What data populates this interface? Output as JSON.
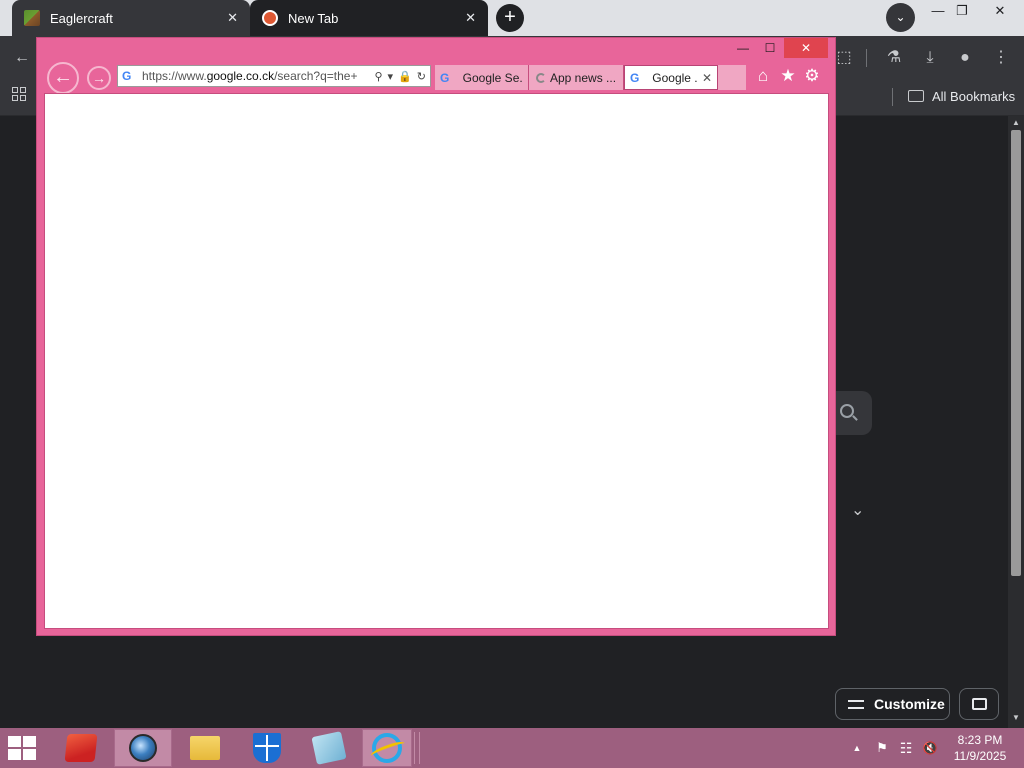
{
  "chrome": {
    "tabs": [
      {
        "title": "Eaglercraft",
        "close": "✕",
        "favicon": "eaglercraft-favicon"
      },
      {
        "title": "New Tab",
        "close": "✕",
        "favicon": "duckduckgo-favicon"
      }
    ],
    "new_tab_symbol": "+",
    "tab_search_symbol": "⌄",
    "window_controls": {
      "minimize": "—",
      "restore": "❐",
      "close": "✕"
    },
    "toolbar_icons": {
      "back": "←",
      "extensions": "⬚",
      "labs": "⚗",
      "download": "⤓",
      "profile": "●",
      "menu": "⋮"
    },
    "bookmarks": {
      "all_bookmarks_label": "All Bookmarks"
    },
    "ntp": {
      "customize_label": "Customize",
      "chevron": "⌄"
    },
    "scroll_arrows": {
      "up": "▲",
      "down": "▼"
    }
  },
  "ie": {
    "caption": {
      "minimize": "—",
      "maximize": "☐",
      "close": "✕"
    },
    "nav": {
      "back": "←",
      "forward": "→"
    },
    "address": {
      "url_prefix": "https://www.",
      "url_domain": "google.co.ck",
      "url_rest": "/search?q=the+",
      "search_icon": "⚲",
      "dropdown_icon": "▾",
      "lock_icon": "🔒",
      "refresh_icon": "↻"
    },
    "tabs": [
      {
        "label": "Google Se...",
        "favicon": "google-favicon",
        "active": false
      },
      {
        "label": "App news ...",
        "favicon": "loading-spinner",
        "active": false
      },
      {
        "label": "Google ...",
        "favicon": "google-favicon",
        "active": true,
        "close": "✕"
      }
    ],
    "favicon_letter": "G",
    "tool_icons": {
      "home": "⌂",
      "favorites": "★",
      "settings": "⚙"
    }
  },
  "taskbar": {
    "items": [
      {
        "name": "toolbox-app-icon",
        "active": false
      },
      {
        "name": "globe-app-icon",
        "active": true
      },
      {
        "name": "file-explorer-icon",
        "active": false
      },
      {
        "name": "security-shield-icon",
        "active": false
      },
      {
        "name": "notepad-app-icon",
        "active": false
      },
      {
        "name": "internet-explorer-icon",
        "active": true
      }
    ],
    "tray": {
      "show_hidden": "▲",
      "action_center": "⚑",
      "network": "☷",
      "volume": "🔇"
    },
    "clock": {
      "time": "8:23 PM",
      "date": "11/9/2025"
    }
  },
  "colors": {
    "chrome_dark": "#202124",
    "chrome_toolbar": "#35363a",
    "ie_frame_pink": "#e8659a",
    "taskbar_mauve": "#9d5f7f",
    "ie_close_red": "#e0444f"
  }
}
